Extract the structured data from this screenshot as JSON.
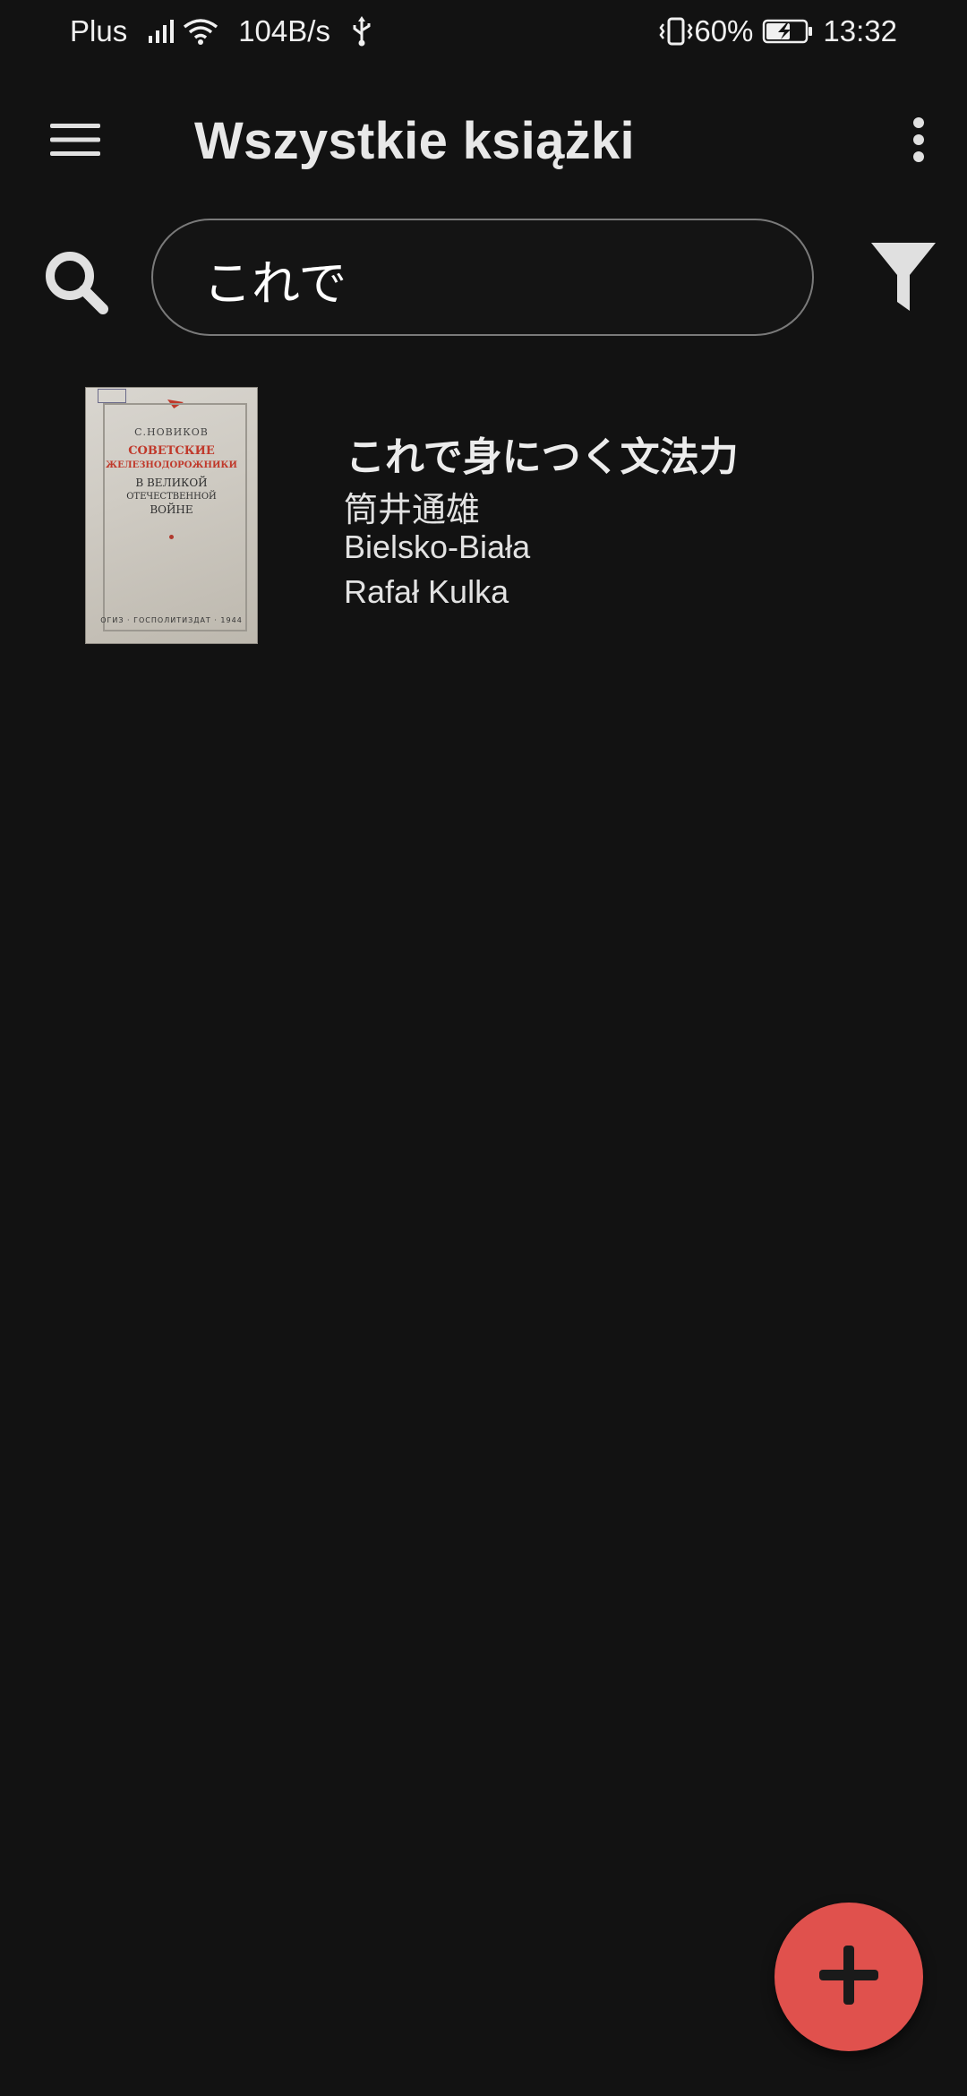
{
  "status_bar": {
    "carrier": "Plus",
    "network_speed": "104B/s",
    "battery_percent": "60%",
    "time": "13:32",
    "icons": [
      "signal-icon",
      "wifi-icon",
      "usb-icon",
      "vibrate-icon",
      "battery-charging-icon"
    ]
  },
  "app_bar": {
    "title": "Wszystkie książki",
    "icons": [
      "menu-icon",
      "more-vert-icon"
    ]
  },
  "search": {
    "value": "これで",
    "icons": [
      "search-icon",
      "filter-icon"
    ]
  },
  "books": [
    {
      "title": "これで身につく文法力",
      "author": "筒井通雄",
      "location": "Bielsko-Biała",
      "owner": "Rafał Kulka",
      "cover": {
        "author": "С.НОВИКОВ",
        "title_line1": "СОВЕТСКИЕ",
        "title_line2": "ЖЕЛЕЗНОДОРОЖНИКИ",
        "sub_line1": "В ВЕЛИКОЙ",
        "sub_line2": "ОТЕЧЕСТВЕННОЙ",
        "sub_line3": "ВОЙНЕ",
        "publisher": "ОГИЗ · ГОСПОЛИТИЗДАТ · 1944"
      }
    }
  ],
  "fab": {
    "icon": "plus-icon"
  },
  "colors": {
    "background": "#121212",
    "fab": "#e0514d",
    "text": "#e6e6e6",
    "search_border": "#7a7a7a"
  }
}
